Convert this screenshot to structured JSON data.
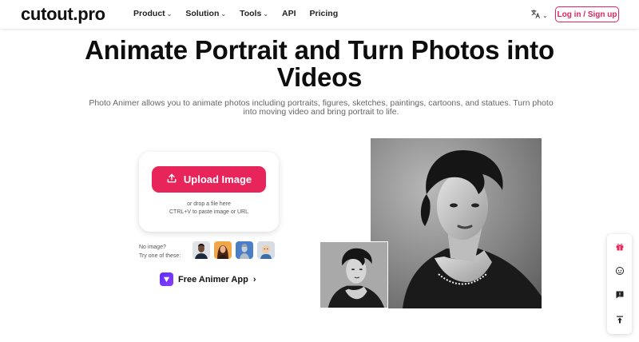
{
  "brand": {
    "logo": "cutout.pro"
  },
  "nav": {
    "items": [
      {
        "label": "Product",
        "has_dropdown": true
      },
      {
        "label": "Solution",
        "has_dropdown": true
      },
      {
        "label": "Tools",
        "has_dropdown": true
      },
      {
        "label": "API",
        "has_dropdown": false
      },
      {
        "label": "Pricing",
        "has_dropdown": false
      }
    ],
    "language_icon": "translate-icon",
    "login_label": "Log in / Sign up"
  },
  "hero": {
    "title_line1": "Animate Portrait and Turn Photos into",
    "title_line2": "Videos",
    "subtitle_line1": "Photo Animer allows you to animate photos including portraits, figures, sketches, paintings, cartoons, and statues. Turn photo",
    "subtitle_line2": "into moving video and bring portrait to life."
  },
  "upload": {
    "button_label": "Upload Image",
    "drop_line1": "or drop a file here",
    "drop_line2": "CTRL+V to paste image or URL"
  },
  "samples": {
    "label_line1": "No image?",
    "label_line2": "Try one of these:",
    "items": [
      "sample-man",
      "sample-woman",
      "sample-statue",
      "sample-baby"
    ]
  },
  "app_link": {
    "label": "Free Animer App",
    "arrow": "›"
  },
  "sidebar": {
    "icons": [
      "gift-icon",
      "face-icon",
      "feedback-icon",
      "back-to-top-icon"
    ]
  },
  "colors": {
    "accent": "#e8255b",
    "app_purple": "#6a33ff",
    "text_dark": "#0d0d0d",
    "text_muted": "#666666"
  }
}
